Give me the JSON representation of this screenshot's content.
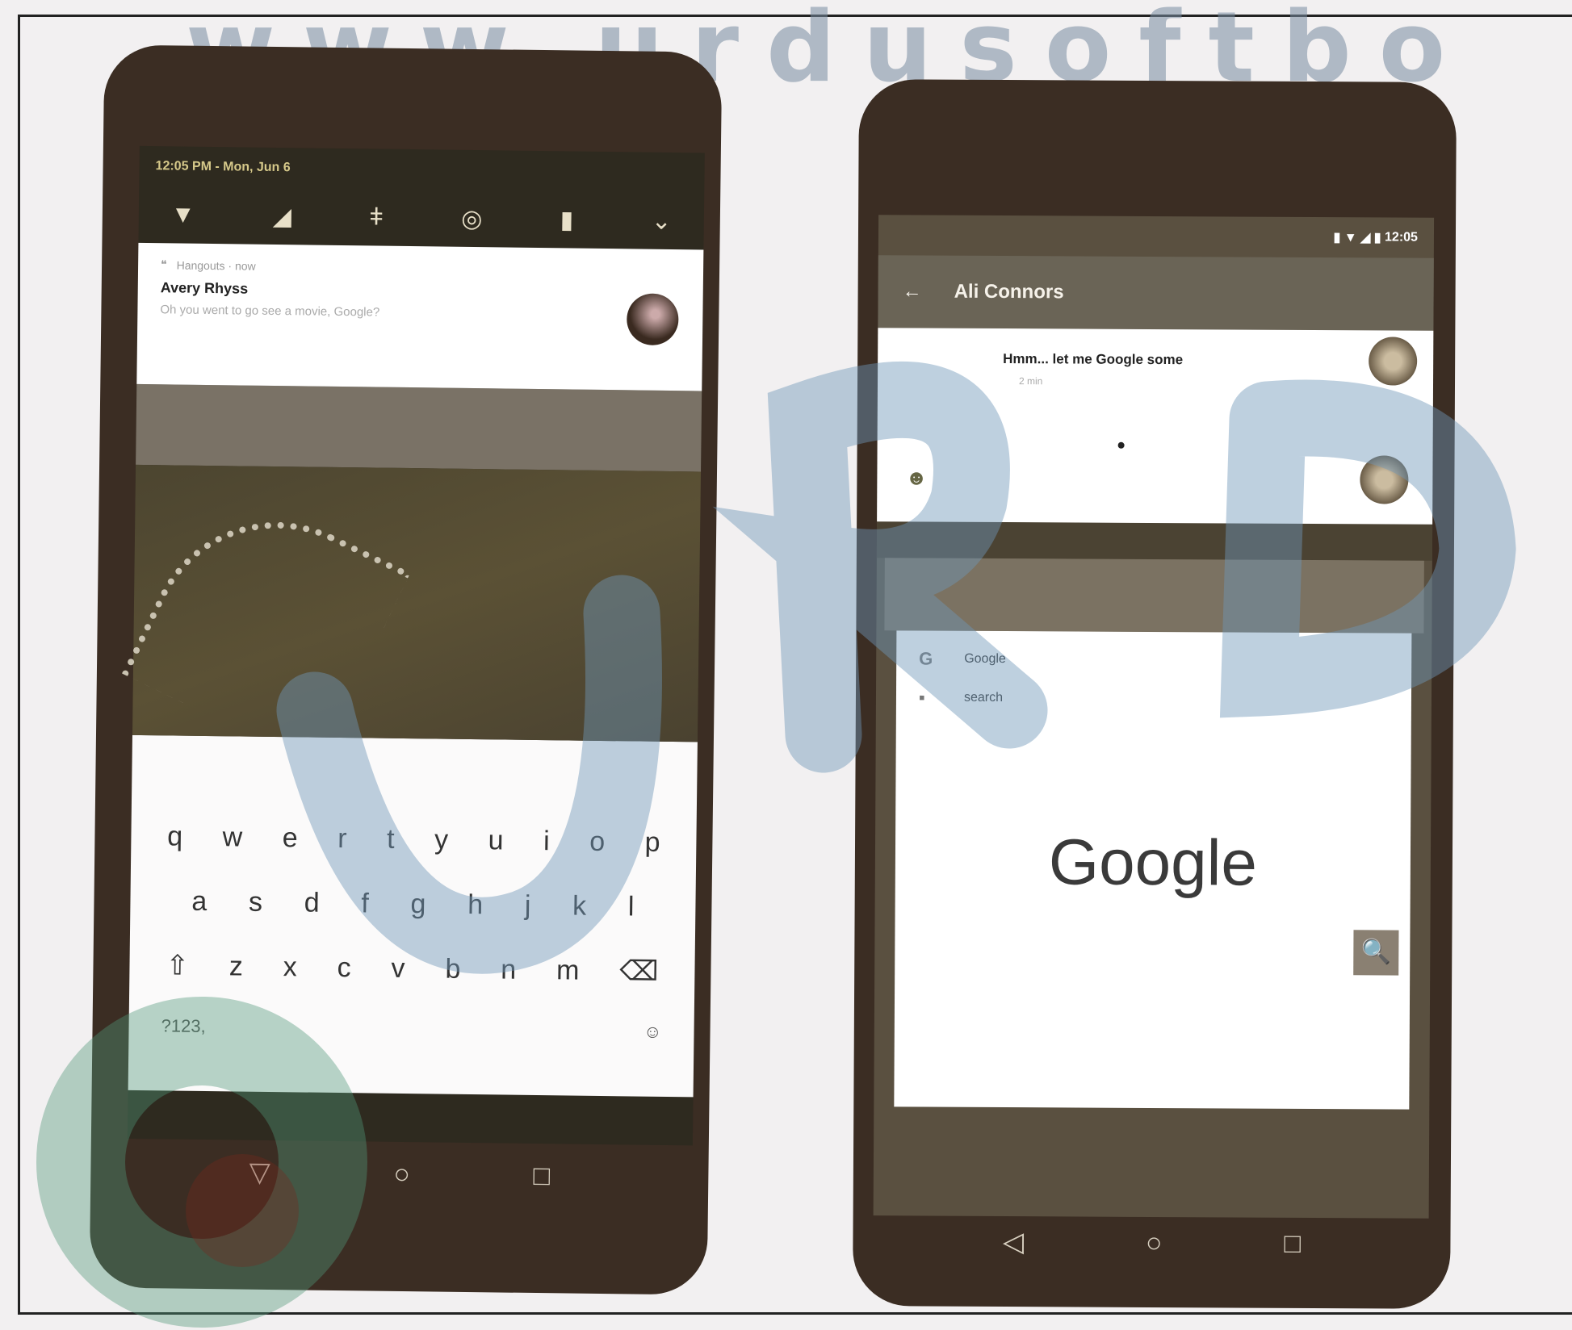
{
  "watermark": {
    "url": "www.urdusoftbo"
  },
  "phone_left": {
    "status": {
      "time_date": "12:05 PM - Mon, Jun 6"
    },
    "quick_settings": [
      "wifi-icon",
      "signal-icon",
      "flashlight-icon",
      "rotate-icon",
      "battery-icon",
      "expand-icon"
    ],
    "notification": {
      "app": "Hangouts · now",
      "title": "Avery Rhyss",
      "body": "Oh you went to go see a movie, Google?"
    },
    "keyboard": {
      "row1": [
        "q",
        "w",
        "e",
        "r",
        "t",
        "y",
        "u",
        "i",
        "o",
        "p"
      ],
      "row2": [
        "a",
        "s",
        "d",
        "f",
        "g",
        "h",
        "j",
        "k",
        "l"
      ],
      "row3": [
        "⇧",
        "z",
        "x",
        "c",
        "v",
        "b",
        "n",
        "m",
        "⌫"
      ],
      "symbols_key": "?123",
      "comma_key": ",",
      "send_key": "☺"
    },
    "nav": {
      "back": "▽",
      "home": "○",
      "recents": "□"
    }
  },
  "phone_right": {
    "status": {
      "time": "12:05"
    },
    "toolbar": {
      "back": "←",
      "title": "Ali Connors"
    },
    "chat": {
      "message": "Hmm... let me Google some",
      "timestamp": "2 min"
    },
    "google_card": {
      "app_name": "Google",
      "tab_label": "search",
      "logo": "Google",
      "search_icon": "🔍"
    },
    "nav": {
      "back": "◁",
      "home": "○",
      "recents": "□"
    }
  },
  "colors": {
    "phone_body": "#3b2d23",
    "watermark": "#7a8ca0"
  }
}
